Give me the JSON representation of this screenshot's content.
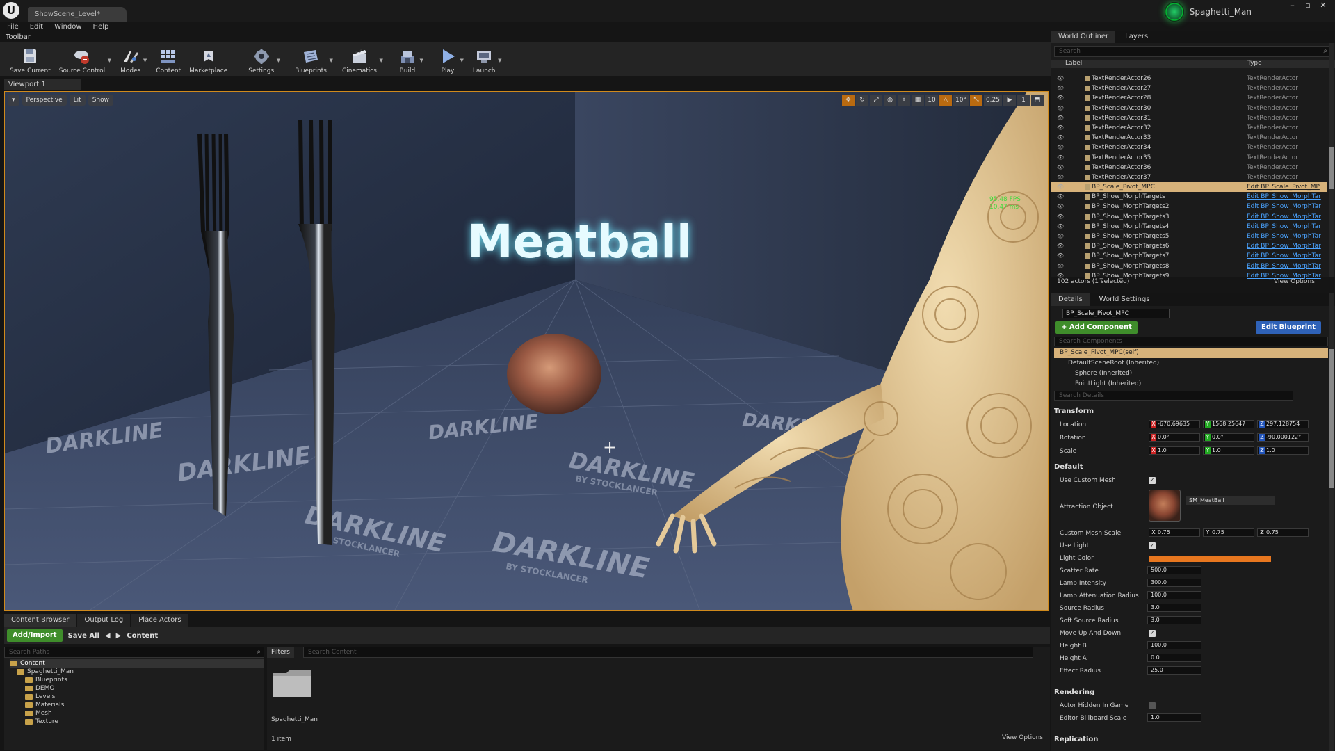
{
  "app": {
    "logo": "U",
    "doc_tab": "ShowScene_Level*",
    "user": "Spaghetti_Man",
    "win": [
      "–",
      "▫",
      "✕"
    ]
  },
  "menu": [
    "File",
    "Edit",
    "Window",
    "Help"
  ],
  "toolbar": {
    "title": "Toolbar",
    "buttons": [
      {
        "label": "Save Current",
        "icon": "save-icon"
      },
      {
        "label": "Source Control",
        "icon": "source-control-icon"
      },
      {
        "label": "Modes",
        "icon": "modes-icon"
      },
      {
        "label": "Content",
        "icon": "content-icon"
      },
      {
        "label": "Marketplace",
        "icon": "marketplace-icon"
      },
      {
        "label": "Settings",
        "icon": "gear-icon"
      },
      {
        "label": "Blueprints",
        "icon": "blueprints-icon"
      },
      {
        "label": "Cinematics",
        "icon": "cinematics-icon"
      },
      {
        "label": "Build",
        "icon": "build-icon"
      },
      {
        "label": "Play",
        "icon": "play-icon"
      },
      {
        "label": "Launch",
        "icon": "launch-icon"
      }
    ]
  },
  "viewport": {
    "tab": "Viewport 1",
    "buttons": [
      "Perspective",
      "Lit",
      "Show"
    ],
    "right_controls": [
      "10",
      "10°",
      "0.25",
      "1"
    ],
    "fps": "95.48 FPS",
    "ms": "10.47 ms",
    "scene_text": "Meatball",
    "floor_text": "DARKLINE",
    "floor_subtext": "BY STOCKLANCER"
  },
  "colors": {
    "accent_orange": "#d08a1c",
    "selection": "#d7b27a",
    "link_blue": "#4aa3ff",
    "add_green": "#3f8d2b",
    "edit_blue": "#2f62b8",
    "light_color": "#e8771f",
    "meatball_text": "#e6fbff"
  },
  "content_browser": {
    "tabs": [
      "Content Browser",
      "Output Log",
      "Place Actors"
    ],
    "add_import": "Add/Import",
    "save_all": "Save All",
    "path": "Content",
    "search_paths": "Search Paths",
    "filters": "Filters",
    "search_content": "Search Content",
    "tree": [
      "Content",
      "Spaghetti_Man",
      "Blueprints",
      "DEMO",
      "Levels",
      "Materials",
      "Mesh",
      "Texture"
    ],
    "folder_name": "Spaghetti_Man",
    "item_count": "1 item",
    "view_options": "View Options"
  },
  "outliner": {
    "tabs": [
      "World Outliner",
      "Layers"
    ],
    "search": "Search",
    "col_label": "Label",
    "col_type": "Type",
    "rows": [
      {
        "label": "TextRenderActor26",
        "type": "TextRenderActor"
      },
      {
        "label": "TextRenderActor27",
        "type": "TextRenderActor"
      },
      {
        "label": "TextRenderActor28",
        "type": "TextRenderActor"
      },
      {
        "label": "TextRenderActor30",
        "type": "TextRenderActor"
      },
      {
        "label": "TextRenderActor31",
        "type": "TextRenderActor"
      },
      {
        "label": "TextRenderActor32",
        "type": "TextRenderActor"
      },
      {
        "label": "TextRenderActor33",
        "type": "TextRenderActor"
      },
      {
        "label": "TextRenderActor34",
        "type": "TextRenderActor"
      },
      {
        "label": "TextRenderActor35",
        "type": "TextRenderActor"
      },
      {
        "label": "TextRenderActor36",
        "type": "TextRenderActor"
      },
      {
        "label": "TextRenderActor37",
        "type": "TextRenderActor"
      },
      {
        "label": "BP_Scale_Pivot_MPC",
        "type": "Edit BP_Scale_Pivot_MP"
      },
      {
        "label": "BP_Show_MorphTargets",
        "type": "Edit BP_Show_MorphTar"
      },
      {
        "label": "BP_Show_MorphTargets2",
        "type": "Edit BP_Show_MorphTar"
      },
      {
        "label": "BP_Show_MorphTargets3",
        "type": "Edit BP_Show_MorphTar"
      },
      {
        "label": "BP_Show_MorphTargets4",
        "type": "Edit BP_Show_MorphTar"
      },
      {
        "label": "BP_Show_MorphTargets5",
        "type": "Edit BP_Show_MorphTar"
      },
      {
        "label": "BP_Show_MorphTargets6",
        "type": "Edit BP_Show_MorphTar"
      },
      {
        "label": "BP_Show_MorphTargets7",
        "type": "Edit BP_Show_MorphTar"
      },
      {
        "label": "BP_Show_MorphTargets8",
        "type": "Edit BP_Show_MorphTar"
      },
      {
        "label": "BP_Show_MorphTargets9",
        "type": "Edit BP_Show_MorphTar"
      }
    ],
    "status": "102 actors (1 selected)",
    "view_options": "View Options"
  },
  "details": {
    "tabs": [
      "Details",
      "World Settings"
    ],
    "object_name": "BP_Scale_Pivot_MPC",
    "add_component": "+ Add Component",
    "edit_blueprint": "Edit Blueprint",
    "search_components": "Search Components",
    "components": [
      "BP_Scale_Pivot_MPC(self)",
      "DefaultSceneRoot (Inherited)",
      "Sphere (Inherited)",
      "PointLight (Inherited)"
    ],
    "search_details": "Search Details",
    "transform": {
      "title": "Transform",
      "location_label": "Location",
      "rotation_label": "Rotation",
      "scale_label": "Scale",
      "location": [
        "-670.69635",
        "1568.25647",
        "297.128754"
      ],
      "rotation": [
        "0.0°",
        "0.0°",
        "-90.000122°"
      ],
      "scale": [
        "1.0",
        "1.0",
        "1.0"
      ]
    },
    "default": {
      "title": "Default",
      "use_custom_mesh": "Use Custom Mesh",
      "attraction_object": "Attraction Object",
      "attraction_asset": "SM_MeatBall",
      "custom_mesh_scale": "Custom Mesh Scale",
      "cms": [
        "0.75",
        "0.75",
        "0.75"
      ],
      "use_light": "Use Light",
      "light_color": "Light Color",
      "scatter_rate": "Scatter Rate",
      "scatter_rate_v": "500.0",
      "lamp_intensity": "Lamp Intensity",
      "lamp_intensity_v": "300.0",
      "lamp_att": "Lamp Attenuation Radius",
      "lamp_att_v": "100.0",
      "source_radius": "Source Radius",
      "source_radius_v": "3.0",
      "soft_source_radius": "Soft Source Radius",
      "soft_source_radius_v": "3.0",
      "move_up_down": "Move Up And Down",
      "height_b": "Height B",
      "height_b_v": "100.0",
      "height_a": "Height A",
      "height_a_v": "0.0",
      "effect_radius": "Effect Radius",
      "effect_radius_v": "25.0"
    },
    "rendering": {
      "title": "Rendering",
      "actor_hidden": "Actor Hidden In Game",
      "billboard_scale": "Editor Billboard Scale",
      "billboard_scale_v": "1.0"
    },
    "replication": "Replication"
  }
}
